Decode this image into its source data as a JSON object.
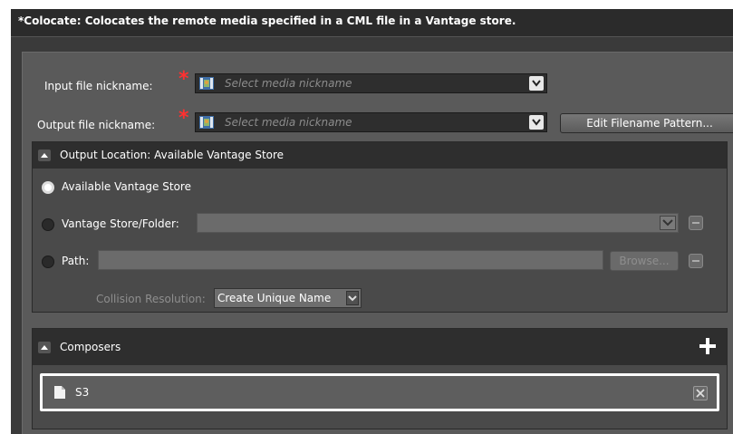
{
  "title": "*Colocate: Colocates the remote media specified in a CML file in a Vantage store.",
  "input": {
    "label": "Input file nickname:",
    "placeholder": "Select media nickname",
    "required_mark": "*"
  },
  "output": {
    "label": "Output file nickname:",
    "placeholder": "Select media nickname",
    "required_mark": "*",
    "edit_button": "Edit Filename Pattern..."
  },
  "output_location": {
    "header": "Output Location: Available Vantage Store",
    "options": [
      {
        "label": "Available Vantage Store",
        "selected": true
      },
      {
        "label": "Vantage Store/Folder:",
        "selected": false
      },
      {
        "label": "Path:",
        "selected": false
      }
    ],
    "browse_button": "Browse...",
    "collision_label": "Collision Resolution:",
    "collision_value": "Create Unique Name"
  },
  "composers": {
    "header": "Composers",
    "add_icon": "plus-icon",
    "items": [
      {
        "label": "S3",
        "icon": "document-icon"
      }
    ]
  },
  "colors": {
    "required": "#ff3030",
    "panel": "#5a5a5a",
    "header": "#2e2e2e"
  }
}
